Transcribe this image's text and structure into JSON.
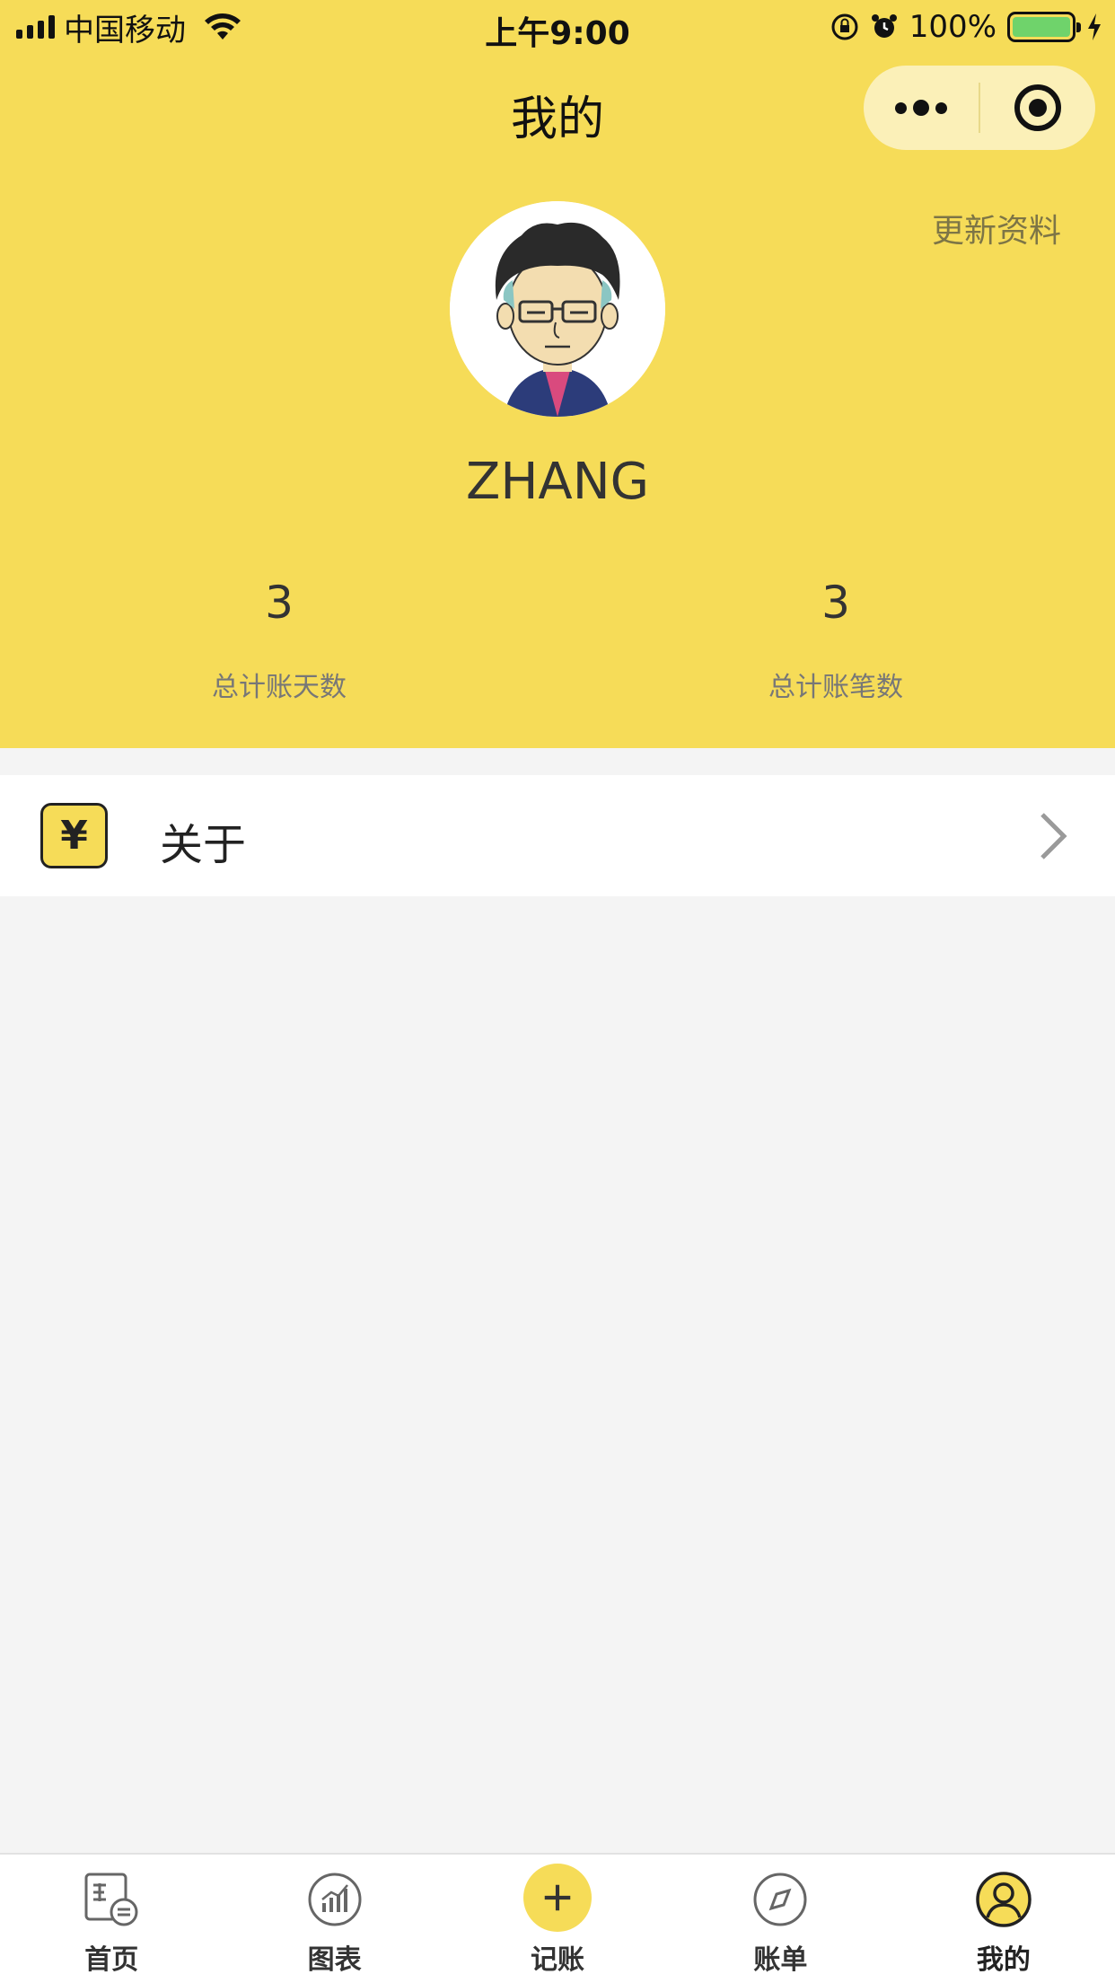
{
  "status_bar": {
    "carrier": "中国移动",
    "time": "上午9:00",
    "battery": "100%"
  },
  "nav": {
    "title": "我的"
  },
  "profile": {
    "update_link": "更新资料",
    "username": "ZHANG"
  },
  "stats": {
    "days_value": "3",
    "days_label": "总计账天数",
    "entries_value": "3",
    "entries_label": "总计账笔数"
  },
  "menu": {
    "about_icon": "¥",
    "about_label": "关于"
  },
  "tabbar": {
    "items": [
      {
        "label": "首页",
        "icon": "ledger-icon"
      },
      {
        "label": "图表",
        "icon": "chart-icon"
      },
      {
        "label": "记账",
        "icon": "plus-icon"
      },
      {
        "label": "账单",
        "icon": "compass-icon"
      },
      {
        "label": "我的",
        "icon": "user-icon"
      }
    ],
    "active_index": 4
  },
  "colors": {
    "brand": "#f6dc58",
    "background": "#f4f4f4"
  }
}
